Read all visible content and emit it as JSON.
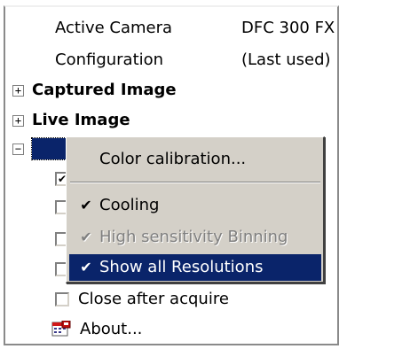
{
  "properties": [
    {
      "label": "Active Camera",
      "value": "DFC 300 FX"
    },
    {
      "label": "Configuration",
      "value": "(Last used)"
    }
  ],
  "groups": [
    {
      "expander": "+",
      "label": "Captured Image"
    },
    {
      "expander": "+",
      "label": "Live Image"
    },
    {
      "expander": "−",
      "label": ""
    }
  ],
  "checkboxes": [
    {
      "checked": "✔",
      "label": ""
    },
    {
      "checked": "",
      "label": ""
    },
    {
      "checked": "",
      "label": ""
    },
    {
      "checked": "",
      "label": ""
    },
    {
      "checked": "",
      "label": "Close after acquire"
    }
  ],
  "about": {
    "label": "About...",
    "icon": "about-app-icon"
  },
  "context_menu": {
    "items": [
      {
        "label": "Color calibration...",
        "check": "",
        "state": "normal"
      },
      {
        "label": "Cooling",
        "check": "✔",
        "state": "normal"
      },
      {
        "label": "High sensitivity Binning",
        "check": "✔",
        "state": "disabled"
      },
      {
        "label": "Show all Resolutions",
        "check": "✔",
        "state": "selected"
      }
    ]
  },
  "colors": {
    "selection": "#0a246a",
    "menu_background": "#d4d0c8",
    "disabled_text": "#808080"
  }
}
